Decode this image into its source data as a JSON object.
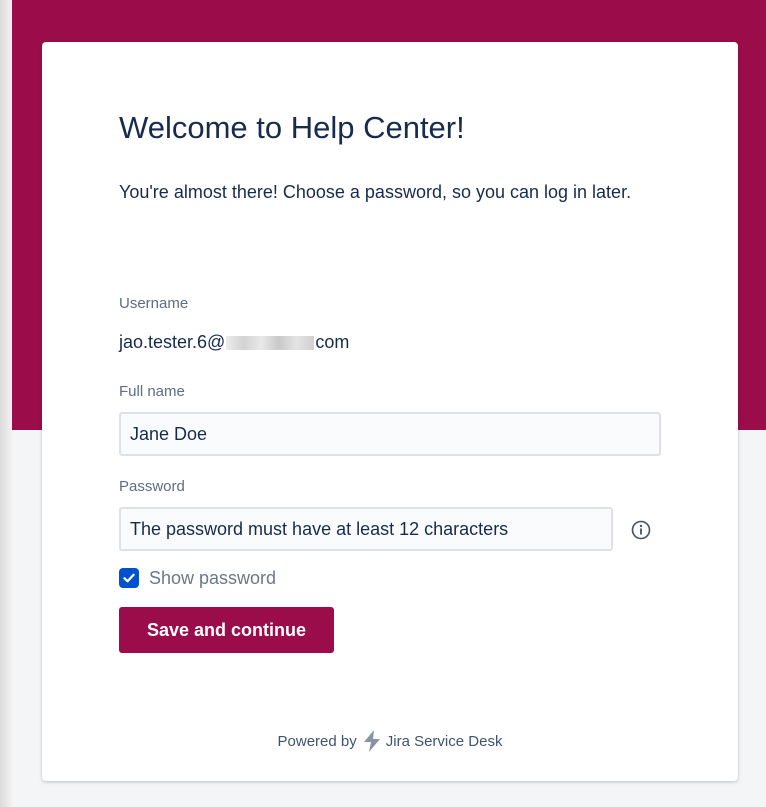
{
  "page": {
    "title": "Welcome to Help Center!",
    "intro": "You're almost there! Choose a password, so you can log in later."
  },
  "username": {
    "label": "Username",
    "value_prefix": "jao.tester.6@",
    "value_suffix": "com"
  },
  "full_name": {
    "label": "Full name",
    "value": "Jane Doe"
  },
  "password": {
    "label": "Password",
    "value": "The password must have at least 12 characters",
    "info_icon": "info-circle-icon"
  },
  "show_password": {
    "label": "Show password",
    "checked": true
  },
  "actions": {
    "save_label": "Save and continue"
  },
  "footer": {
    "powered_by": "Powered by",
    "product": "Jira Service Desk",
    "logo_icon": "lightning-bolt-icon"
  },
  "colors": {
    "brand": "#9b0c4a",
    "checkbox": "#0052cc",
    "text": "#172b4d",
    "page_background": "#f4f5f7"
  }
}
